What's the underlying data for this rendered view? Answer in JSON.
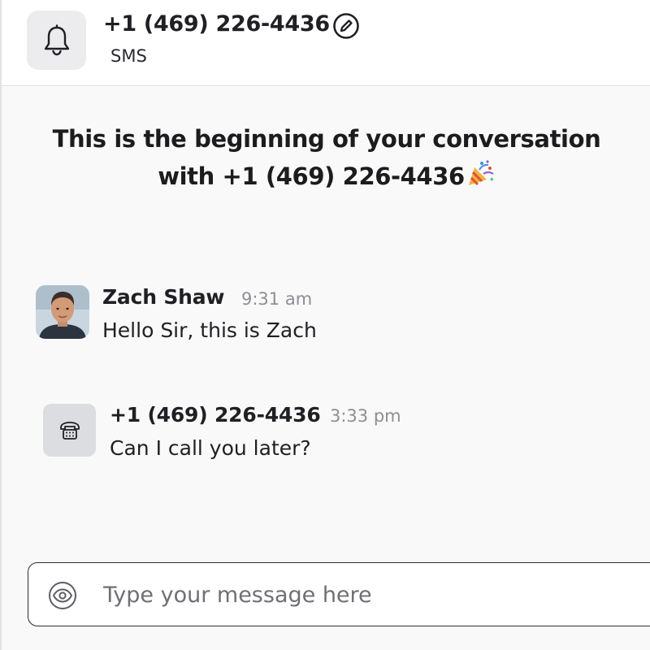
{
  "header": {
    "title": "+1 (469) 226-4436",
    "subtitle": "SMS",
    "bell_icon": "bell-icon",
    "edit_icon": "edit-icon"
  },
  "intro": {
    "line1": "This is the beginning of your conversation",
    "line2": "with +1 (469) 226-4436",
    "emoji_icon": "party-popper-icon"
  },
  "messages": [
    {
      "sender": "Zach Shaw",
      "time": "9:31 am",
      "text": "Hello Sir, this is Zach",
      "avatar": "avatar-photo"
    },
    {
      "sender": "+1 (469) 226-4436",
      "time": "3:33 pm",
      "text": "Can I call you later?",
      "avatar": "phone-icon"
    }
  ],
  "composer": {
    "placeholder": "Type your message here",
    "value": "",
    "eye_icon": "eye-icon"
  },
  "colors": {
    "background": "#f9f9f9",
    "tile": "#ececee",
    "muted_text": "#8e8e96"
  }
}
